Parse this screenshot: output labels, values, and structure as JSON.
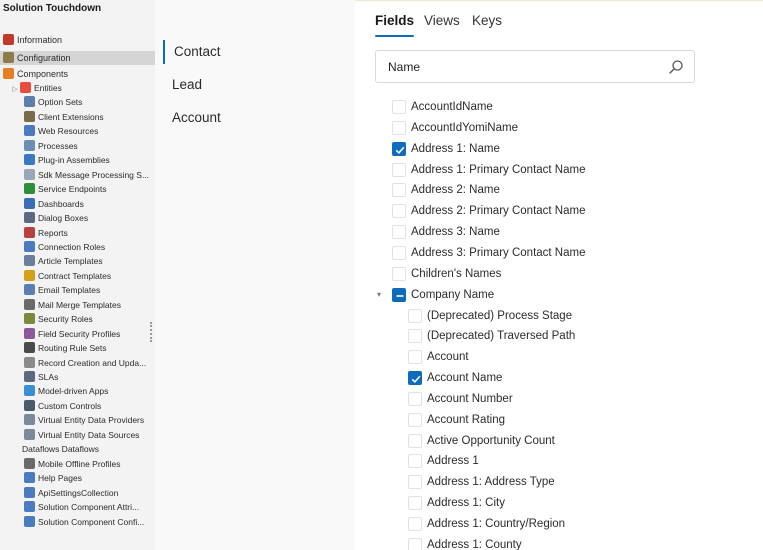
{
  "explorer": {
    "title": "Solution Touchdown",
    "items": [
      {
        "label": "Information",
        "icon": "information-icon",
        "color": "#c0392b",
        "indent": 0,
        "top": true
      },
      {
        "label": "Configuration",
        "icon": "configuration-icon",
        "color": "#8d7b4a",
        "indent": 0,
        "top": true,
        "selected": true
      },
      {
        "label": "Components",
        "icon": "components-icon",
        "color": "#e67e22",
        "indent": 0,
        "top": true
      },
      {
        "label": "Entities",
        "icon": "entities-icon",
        "color": "#e74c3c",
        "indent": 1,
        "expander": true
      },
      {
        "label": "Option Sets",
        "icon": "option-sets-icon",
        "color": "#5b7fa8",
        "indent": 2
      },
      {
        "label": "Client Extensions",
        "icon": "client-extensions-icon",
        "color": "#7a6b4a",
        "indent": 2
      },
      {
        "label": "Web Resources",
        "icon": "web-resources-icon",
        "color": "#4a7abf",
        "indent": 2
      },
      {
        "label": "Processes",
        "icon": "processes-icon",
        "color": "#6a8fb5",
        "indent": 2
      },
      {
        "label": "Plug-in Assemblies",
        "icon": "plugin-assemblies-icon",
        "color": "#3a78c2",
        "indent": 2
      },
      {
        "label": "Sdk Message Processing S...",
        "icon": "sdk-message-icon",
        "color": "#9aa7b8",
        "indent": 2
      },
      {
        "label": "Service Endpoints",
        "icon": "service-endpoints-icon",
        "color": "#2d8f3a",
        "indent": 2
      },
      {
        "label": "Dashboards",
        "icon": "dashboards-icon",
        "color": "#3a6db5",
        "indent": 2
      },
      {
        "label": "Dialog Boxes",
        "icon": "dialog-boxes-icon",
        "color": "#5a6a80",
        "indent": 2
      },
      {
        "label": "Reports",
        "icon": "reports-icon",
        "color": "#b84040",
        "indent": 2
      },
      {
        "label": "Connection Roles",
        "icon": "connection-roles-icon",
        "color": "#4a7abf",
        "indent": 2
      },
      {
        "label": "Article Templates",
        "icon": "article-templates-icon",
        "color": "#6a7f9a",
        "indent": 2
      },
      {
        "label": "Contract Templates",
        "icon": "contract-templates-icon",
        "color": "#d4a017",
        "indent": 2
      },
      {
        "label": "Email Templates",
        "icon": "email-templates-icon",
        "color": "#5a7fb0",
        "indent": 2
      },
      {
        "label": "Mail Merge Templates",
        "icon": "mail-merge-icon",
        "color": "#6a6a6a",
        "indent": 2
      },
      {
        "label": "Security Roles",
        "icon": "security-roles-icon",
        "color": "#7a8a3a",
        "indent": 2
      },
      {
        "label": "Field Security Profiles",
        "icon": "field-security-icon",
        "color": "#8a5a9a",
        "indent": 2
      },
      {
        "label": "Routing Rule Sets",
        "icon": "routing-rule-icon",
        "color": "#4a4a4a",
        "indent": 2
      },
      {
        "label": "Record Creation and Upda...",
        "icon": "record-creation-icon",
        "color": "#8a8a8a",
        "indent": 2
      },
      {
        "label": "SLAs",
        "icon": "slas-icon",
        "color": "#5a6a80",
        "indent": 2
      },
      {
        "label": "Model-driven Apps",
        "icon": "model-driven-apps-icon",
        "color": "#3a8fd4",
        "indent": 2
      },
      {
        "label": "Custom Controls",
        "icon": "custom-controls-icon",
        "color": "#4a5a6a",
        "indent": 2
      },
      {
        "label": "Virtual Entity Data Providers",
        "icon": "virtual-entity-providers-icon",
        "color": "#7a8a9a",
        "indent": 2
      },
      {
        "label": "Virtual Entity Data Sources",
        "icon": "virtual-entity-sources-icon",
        "color": "#7a8a9a",
        "indent": 2
      },
      {
        "label": "Dataflows Dataflows",
        "icon": "",
        "color": "",
        "indent": 1
      },
      {
        "label": "Mobile Offline Profiles",
        "icon": "mobile-offline-icon",
        "color": "#6a6a6a",
        "indent": 2
      },
      {
        "label": "Help Pages",
        "icon": "help-pages-icon",
        "color": "#4a7abf",
        "indent": 2
      },
      {
        "label": "ApiSettingsCollection",
        "icon": "api-settings-icon",
        "color": "#4a7abf",
        "indent": 2
      },
      {
        "label": "Solution Component Attri...",
        "icon": "solution-component-attr-icon",
        "color": "#4a7abf",
        "indent": 2
      },
      {
        "label": "Solution Component Confi...",
        "icon": "solution-component-conf-icon",
        "color": "#4a7abf",
        "indent": 2
      }
    ]
  },
  "entities": [
    {
      "label": "Contact",
      "active": true
    },
    {
      "label": "Lead",
      "active": false
    },
    {
      "label": "Account",
      "active": false
    }
  ],
  "tabs": [
    {
      "label": "Fields",
      "active": true
    },
    {
      "label": "Views",
      "active": false
    },
    {
      "label": "Keys",
      "active": false
    }
  ],
  "search": {
    "value": "Name",
    "placeholder": ""
  },
  "accent": "#0f6cbd",
  "fields": [
    {
      "label": "AccountIdName",
      "state": "unchecked",
      "level": 0
    },
    {
      "label": "AccountIdYomiName",
      "state": "unchecked",
      "level": 0
    },
    {
      "label": "Address 1: Name",
      "state": "checked",
      "level": 0
    },
    {
      "label": "Address 1: Primary Contact Name",
      "state": "unchecked",
      "level": 0
    },
    {
      "label": "Address 2: Name",
      "state": "unchecked",
      "level": 0
    },
    {
      "label": "Address 2: Primary Contact Name",
      "state": "unchecked",
      "level": 0
    },
    {
      "label": "Address 3: Name",
      "state": "unchecked",
      "level": 0
    },
    {
      "label": "Address 3: Primary Contact Name",
      "state": "unchecked",
      "level": 0
    },
    {
      "label": "Children's Names",
      "state": "unchecked",
      "level": 0
    },
    {
      "label": "Company Name",
      "state": "indeterminate",
      "level": 0,
      "expander": true
    },
    {
      "label": "(Deprecated) Process Stage",
      "state": "unchecked",
      "level": 1
    },
    {
      "label": "(Deprecated) Traversed Path",
      "state": "unchecked",
      "level": 1
    },
    {
      "label": "Account",
      "state": "unchecked",
      "level": 1
    },
    {
      "label": "Account Name",
      "state": "checked",
      "level": 1
    },
    {
      "label": "Account Number",
      "state": "unchecked",
      "level": 1
    },
    {
      "label": "Account Rating",
      "state": "unchecked",
      "level": 1
    },
    {
      "label": "Active Opportunity Count",
      "state": "unchecked",
      "level": 1
    },
    {
      "label": "Address 1",
      "state": "unchecked",
      "level": 1
    },
    {
      "label": "Address 1: Address Type",
      "state": "unchecked",
      "level": 1
    },
    {
      "label": "Address 1: City",
      "state": "unchecked",
      "level": 1
    },
    {
      "label": "Address 1: Country/Region",
      "state": "unchecked",
      "level": 1
    },
    {
      "label": "Address 1: County",
      "state": "unchecked",
      "level": 1
    }
  ]
}
